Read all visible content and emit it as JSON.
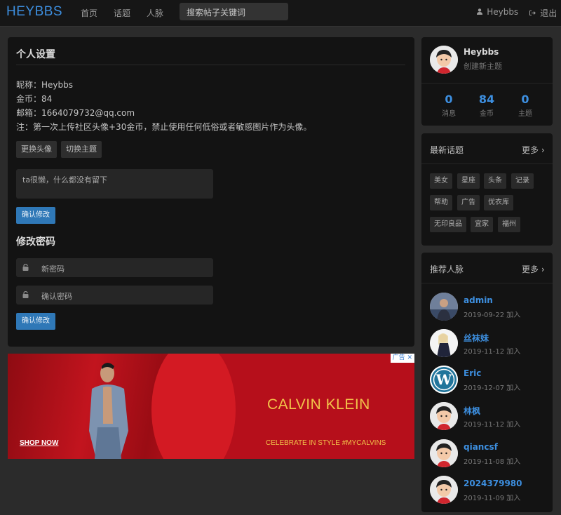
{
  "header": {
    "brand": "HEYBBS",
    "nav": [
      "首页",
      "话题",
      "人脉"
    ],
    "search_placeholder": "搜索帖子关键词",
    "user": "Heybbs",
    "logout": "退出"
  },
  "settings": {
    "title": "个人设置",
    "nickname": "昵称：Heybbs",
    "coins": "金币：84",
    "email": "邮箱：1664079732@qq.com",
    "note": "注：第一次上传社区头像+30金币，禁止使用任何低俗或者敏感图片作为头像。",
    "change_avatar": "更换头像",
    "change_theme": "切换主题",
    "bio": "ta很懒，什么都没有留下",
    "confirm": "确认修改"
  },
  "password": {
    "title": "修改密码",
    "new_placeholder": "新密码",
    "confirm_placeholder": "确认密码",
    "confirm": "确认修改"
  },
  "ad": {
    "shop": "SHOP NOW",
    "brand": "CALVIN KLEIN",
    "tagline": "CELEBRATE IN STYLE #MYCALVINS",
    "badge": "广告"
  },
  "profile": {
    "name": "Heybbs",
    "sub": "创建新主题",
    "stats": [
      {
        "value": "0",
        "label": "消息"
      },
      {
        "value": "84",
        "label": "金币"
      },
      {
        "value": "0",
        "label": "主题"
      }
    ]
  },
  "topics": {
    "title": "最新话题",
    "more": "更多",
    "tags": [
      "美女",
      "星座",
      "头条",
      "记录",
      "帮助",
      "广告",
      "优衣库",
      "无印良品",
      "宜家",
      "福州"
    ]
  },
  "people": {
    "title": "推荐人脉",
    "more": "更多",
    "users": [
      {
        "name": "admin",
        "date": "2019-09-22 加入"
      },
      {
        "name": "丝袜妹",
        "date": "2019-11-12 加入"
      },
      {
        "name": "Eric",
        "date": "2019-12-07 加入"
      },
      {
        "name": "林枫",
        "date": "2019-11-12 加入"
      },
      {
        "name": "qiancsf",
        "date": "2019-11-08 加入"
      },
      {
        "name": "2024379980",
        "date": "2019-11-09 加入"
      }
    ]
  },
  "colors": {
    "accent": "#3d8fe0",
    "button": "#2f78b7",
    "panel": "#131313",
    "page": "#2b2b2b"
  }
}
